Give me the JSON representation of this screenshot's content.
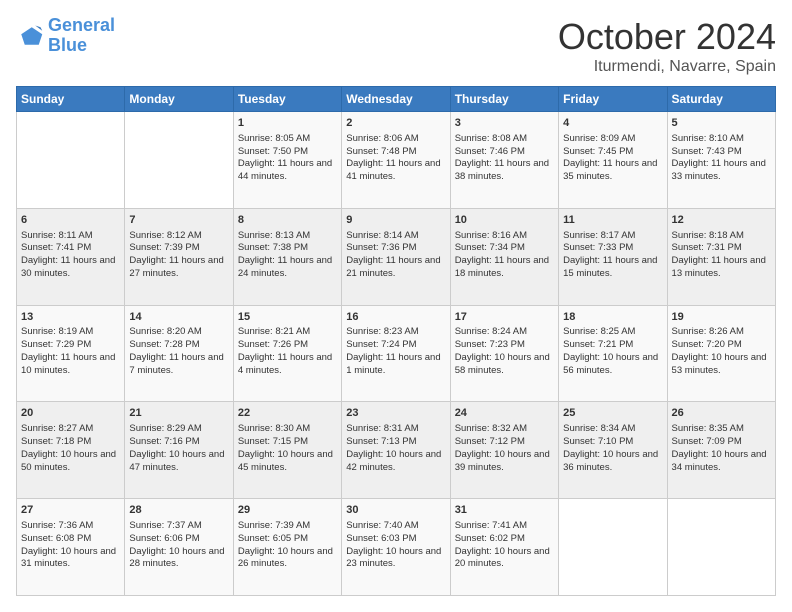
{
  "logo": {
    "line1": "General",
    "line2": "Blue"
  },
  "header": {
    "month": "October 2024",
    "location": "Iturmendi, Navarre, Spain"
  },
  "weekdays": [
    "Sunday",
    "Monday",
    "Tuesday",
    "Wednesday",
    "Thursday",
    "Friday",
    "Saturday"
  ],
  "weeks": [
    [
      {
        "day": "",
        "info": ""
      },
      {
        "day": "",
        "info": ""
      },
      {
        "day": "1",
        "info": "Sunrise: 8:05 AM\nSunset: 7:50 PM\nDaylight: 11 hours and 44 minutes."
      },
      {
        "day": "2",
        "info": "Sunrise: 8:06 AM\nSunset: 7:48 PM\nDaylight: 11 hours and 41 minutes."
      },
      {
        "day": "3",
        "info": "Sunrise: 8:08 AM\nSunset: 7:46 PM\nDaylight: 11 hours and 38 minutes."
      },
      {
        "day": "4",
        "info": "Sunrise: 8:09 AM\nSunset: 7:45 PM\nDaylight: 11 hours and 35 minutes."
      },
      {
        "day": "5",
        "info": "Sunrise: 8:10 AM\nSunset: 7:43 PM\nDaylight: 11 hours and 33 minutes."
      }
    ],
    [
      {
        "day": "6",
        "info": "Sunrise: 8:11 AM\nSunset: 7:41 PM\nDaylight: 11 hours and 30 minutes."
      },
      {
        "day": "7",
        "info": "Sunrise: 8:12 AM\nSunset: 7:39 PM\nDaylight: 11 hours and 27 minutes."
      },
      {
        "day": "8",
        "info": "Sunrise: 8:13 AM\nSunset: 7:38 PM\nDaylight: 11 hours and 24 minutes."
      },
      {
        "day": "9",
        "info": "Sunrise: 8:14 AM\nSunset: 7:36 PM\nDaylight: 11 hours and 21 minutes."
      },
      {
        "day": "10",
        "info": "Sunrise: 8:16 AM\nSunset: 7:34 PM\nDaylight: 11 hours and 18 minutes."
      },
      {
        "day": "11",
        "info": "Sunrise: 8:17 AM\nSunset: 7:33 PM\nDaylight: 11 hours and 15 minutes."
      },
      {
        "day": "12",
        "info": "Sunrise: 8:18 AM\nSunset: 7:31 PM\nDaylight: 11 hours and 13 minutes."
      }
    ],
    [
      {
        "day": "13",
        "info": "Sunrise: 8:19 AM\nSunset: 7:29 PM\nDaylight: 11 hours and 10 minutes."
      },
      {
        "day": "14",
        "info": "Sunrise: 8:20 AM\nSunset: 7:28 PM\nDaylight: 11 hours and 7 minutes."
      },
      {
        "day": "15",
        "info": "Sunrise: 8:21 AM\nSunset: 7:26 PM\nDaylight: 11 hours and 4 minutes."
      },
      {
        "day": "16",
        "info": "Sunrise: 8:23 AM\nSunset: 7:24 PM\nDaylight: 11 hours and 1 minute."
      },
      {
        "day": "17",
        "info": "Sunrise: 8:24 AM\nSunset: 7:23 PM\nDaylight: 10 hours and 58 minutes."
      },
      {
        "day": "18",
        "info": "Sunrise: 8:25 AM\nSunset: 7:21 PM\nDaylight: 10 hours and 56 minutes."
      },
      {
        "day": "19",
        "info": "Sunrise: 8:26 AM\nSunset: 7:20 PM\nDaylight: 10 hours and 53 minutes."
      }
    ],
    [
      {
        "day": "20",
        "info": "Sunrise: 8:27 AM\nSunset: 7:18 PM\nDaylight: 10 hours and 50 minutes."
      },
      {
        "day": "21",
        "info": "Sunrise: 8:29 AM\nSunset: 7:16 PM\nDaylight: 10 hours and 47 minutes."
      },
      {
        "day": "22",
        "info": "Sunrise: 8:30 AM\nSunset: 7:15 PM\nDaylight: 10 hours and 45 minutes."
      },
      {
        "day": "23",
        "info": "Sunrise: 8:31 AM\nSunset: 7:13 PM\nDaylight: 10 hours and 42 minutes."
      },
      {
        "day": "24",
        "info": "Sunrise: 8:32 AM\nSunset: 7:12 PM\nDaylight: 10 hours and 39 minutes."
      },
      {
        "day": "25",
        "info": "Sunrise: 8:34 AM\nSunset: 7:10 PM\nDaylight: 10 hours and 36 minutes."
      },
      {
        "day": "26",
        "info": "Sunrise: 8:35 AM\nSunset: 7:09 PM\nDaylight: 10 hours and 34 minutes."
      }
    ],
    [
      {
        "day": "27",
        "info": "Sunrise: 7:36 AM\nSunset: 6:08 PM\nDaylight: 10 hours and 31 minutes."
      },
      {
        "day": "28",
        "info": "Sunrise: 7:37 AM\nSunset: 6:06 PM\nDaylight: 10 hours and 28 minutes."
      },
      {
        "day": "29",
        "info": "Sunrise: 7:39 AM\nSunset: 6:05 PM\nDaylight: 10 hours and 26 minutes."
      },
      {
        "day": "30",
        "info": "Sunrise: 7:40 AM\nSunset: 6:03 PM\nDaylight: 10 hours and 23 minutes."
      },
      {
        "day": "31",
        "info": "Sunrise: 7:41 AM\nSunset: 6:02 PM\nDaylight: 10 hours and 20 minutes."
      },
      {
        "day": "",
        "info": ""
      },
      {
        "day": "",
        "info": ""
      }
    ]
  ]
}
